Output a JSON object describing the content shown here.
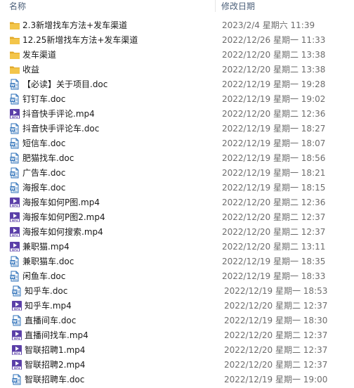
{
  "header": {
    "name_label": "名称",
    "date_label": "修改日期"
  },
  "files": [
    {
      "name": "2.3新增找车方法+发车渠道",
      "date": "2023/2/4 星期六 11:39",
      "icon": "folder-icon"
    },
    {
      "name": "12.25新增找车方法+发车渠道",
      "date": "2022/12/26 星期一 11:33",
      "icon": "folder-icon"
    },
    {
      "name": "发车渠道",
      "date": "2022/12/20 星期二 13:38",
      "icon": "folder-icon"
    },
    {
      "name": "收益",
      "date": "2022/12/20 星期二 13:38",
      "icon": "folder-icon"
    },
    {
      "name": "【必读】关于项目.doc",
      "date": "2022/12/19 星期一 19:28",
      "icon": "doc-icon"
    },
    {
      "name": "钉钉车.doc",
      "date": "2022/12/19 星期一 19:02",
      "icon": "doc-icon"
    },
    {
      "name": "抖音快手评论.mp4",
      "date": "2022/12/20 星期二 12:36",
      "icon": "mp4-icon"
    },
    {
      "name": "抖音快手评论车.doc",
      "date": "2022/12/19 星期一 18:27",
      "icon": "doc-icon"
    },
    {
      "name": "短信车.doc",
      "date": "2022/12/19 星期一 18:07",
      "icon": "doc-icon"
    },
    {
      "name": "肥猫找车.doc",
      "date": "2022/12/19 星期一 18:56",
      "icon": "doc-icon"
    },
    {
      "name": "广告车.doc",
      "date": "2022/12/19 星期一 18:21",
      "icon": "doc-icon"
    },
    {
      "name": "海报车.doc",
      "date": "2022/12/19 星期一 18:15",
      "icon": "doc-icon"
    },
    {
      "name": "海报车如何P图.mp4",
      "date": "2022/12/20 星期二 12:36",
      "icon": "mp4-icon"
    },
    {
      "name": "海报车如何P图2.mp4",
      "date": "2022/12/20 星期二 12:37",
      "icon": "mp4-icon"
    },
    {
      "name": "海报车如何搜索.mp4",
      "date": "2022/12/20 星期二 12:37",
      "icon": "mp4-icon"
    },
    {
      "name": "兼职猫.mp4",
      "date": "2022/12/20 星期二 13:11",
      "icon": "mp4-icon"
    },
    {
      "name": "兼职猫车.doc",
      "date": "2022/12/19 星期一 18:35",
      "icon": "doc-icon"
    },
    {
      "name": "闲鱼车.doc",
      "date": "2022/12/19 星期一 18:33",
      "icon": "doc-icon"
    },
    {
      "name": "知乎车.doc",
      "date": "2022/12/19 星期一 18:53",
      "icon": "doc-icon",
      "indent": true
    },
    {
      "name": "知乎车.mp4",
      "date": "2022/12/20 星期二 12:37",
      "icon": "mp4-icon",
      "indent": true
    },
    {
      "name": "直播间车.doc",
      "date": "2022/12/19 星期一 18:30",
      "icon": "doc-icon",
      "indent": true
    },
    {
      "name": "直播间找车.mp4",
      "date": "2022/12/20 星期二 12:37",
      "icon": "mp4-icon",
      "indent": true
    },
    {
      "name": "智联招聘1.mp4",
      "date": "2022/12/20 星期二 12:37",
      "icon": "mp4-icon",
      "indent": true
    },
    {
      "name": "智联招聘2.mp4",
      "date": "2022/12/20 星期二 12:37",
      "icon": "mp4-icon",
      "indent": true
    },
    {
      "name": "智联招聘车.doc",
      "date": "2022/12/19 星期一 19:00",
      "icon": "doc-icon",
      "indent": true
    }
  ],
  "colors": {
    "folder": "#f3c54a",
    "folder_dark": "#e2a92a",
    "doc_border": "#2b6fb8",
    "mp4_bg": "#5b3fa8",
    "header_text": "#4c607a",
    "date_text": "#6d6d6d"
  }
}
